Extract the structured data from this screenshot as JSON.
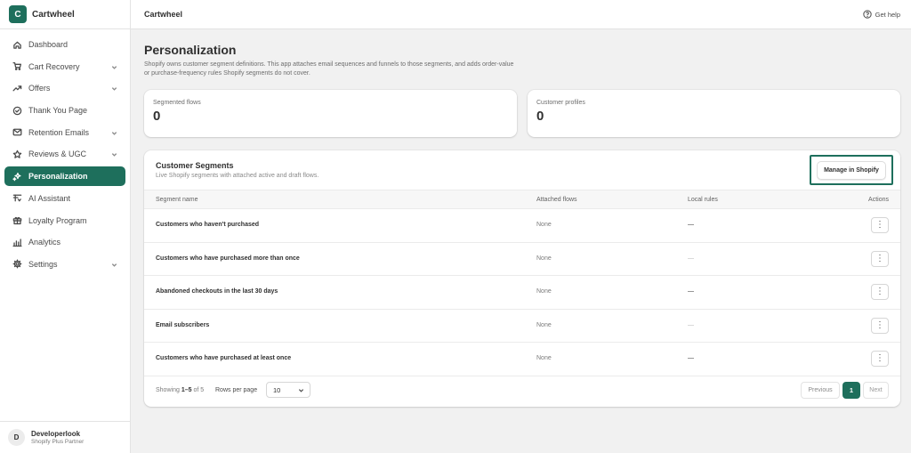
{
  "app": {
    "name": "Cartwheel",
    "logo_letter": "C",
    "accent_color": "#1e6f5c"
  },
  "sidebar": {
    "items": [
      {
        "label": "Dashboard",
        "icon": "home-icon",
        "has_chevron": false,
        "active": false
      },
      {
        "label": "Cart Recovery",
        "icon": "cart-icon",
        "has_chevron": true,
        "active": false
      },
      {
        "label": "Offers",
        "icon": "trending-up-icon",
        "has_chevron": true,
        "active": false
      },
      {
        "label": "Thank You Page",
        "icon": "check-circle-icon",
        "has_chevron": false,
        "active": false
      },
      {
        "label": "Retention Emails",
        "icon": "mail-icon",
        "has_chevron": true,
        "active": false
      },
      {
        "label": "Reviews & UGC",
        "icon": "star-icon",
        "has_chevron": true,
        "active": false
      },
      {
        "label": "Personalization",
        "icon": "sparkles-icon",
        "has_chevron": false,
        "active": true
      },
      {
        "label": "AI Assistant",
        "icon": "ai-icon",
        "has_chevron": false,
        "active": false
      },
      {
        "label": "Loyalty Program",
        "icon": "gift-icon",
        "has_chevron": false,
        "active": false
      },
      {
        "label": "Analytics",
        "icon": "bar-chart-icon",
        "has_chevron": false,
        "active": false
      },
      {
        "label": "Settings",
        "icon": "gear-icon",
        "has_chevron": true,
        "active": false
      }
    ],
    "user": {
      "initial": "D",
      "name": "Developerlook",
      "subtitle": "Shopify Plus Partner"
    }
  },
  "topbar": {
    "title": "Cartwheel",
    "help_label": "Get help"
  },
  "page": {
    "title": "Personalization",
    "description": "Shopify owns customer segment definitions. This app attaches email sequences and funnels to those segments, and adds order-value or purchase-frequency rules Shopify segments do not cover."
  },
  "stats": [
    {
      "label": "Segmented flows",
      "value": "0"
    },
    {
      "label": "Customer profiles",
      "value": "0"
    }
  ],
  "segments_card": {
    "title": "Customer Segments",
    "subtitle": "Live Shopify segments with attached active and draft flows.",
    "manage_button": "Manage in Shopify",
    "columns": {
      "name": "Segment name",
      "flows": "Attached flows",
      "rules": "Local rules",
      "actions": "Actions"
    },
    "rows": [
      {
        "name": "Customers who haven't purchased",
        "flows": "None",
        "rules": "—"
      },
      {
        "name": "Customers who have purchased more than once",
        "flows": "None",
        "rules": "—"
      },
      {
        "name": "Abandoned checkouts in the last 30 days",
        "flows": "None",
        "rules": "—"
      },
      {
        "name": "Email subscribers",
        "flows": "None",
        "rules": "—"
      },
      {
        "name": "Customers who have purchased at least once",
        "flows": "None",
        "rules": "—"
      }
    ],
    "action_glyph": "⋮",
    "pagination": {
      "showing_prefix": "Showing",
      "showing_range": "1–5",
      "showing_suffix": "of 5",
      "rows_per_page_label": "Rows per page",
      "rows_per_page_value": "10",
      "previous": "Previous",
      "current_page": "1",
      "next": "Next"
    }
  }
}
